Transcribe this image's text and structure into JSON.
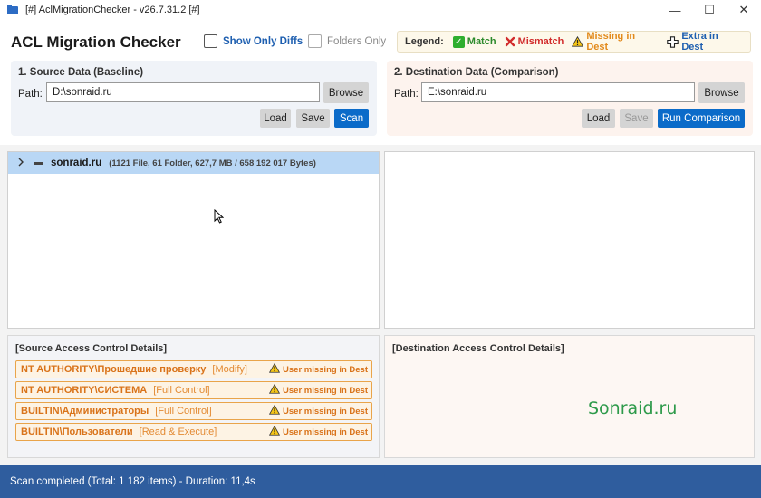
{
  "window": {
    "title": "[#] AclMigrationChecker - v26.7.31.2 [#]",
    "minimize": "—",
    "maximize": "☐",
    "close": "✕"
  },
  "header": {
    "app_title": "ACL Migration Checker",
    "show_only_diffs": "Show Only Diffs",
    "folders_only": "Folders Only"
  },
  "legend": {
    "label": "Legend:",
    "match": "Match",
    "mismatch": "Mismatch",
    "missing": "Missing in Dest",
    "extra": "Extra in Dest",
    "colors": {
      "match": "#2b8a2b",
      "mismatch": "#d12b2b",
      "missing": "#e28a1c",
      "extra": "#1e5fb0"
    }
  },
  "source": {
    "title": "1. Source Data (Baseline)",
    "path_label": "Path:",
    "path_value": "D:\\sonraid.ru",
    "browse": "Browse",
    "load": "Load",
    "save": "Save",
    "scan": "Scan"
  },
  "dest": {
    "title": "2. Destination Data (Comparison)",
    "path_label": "Path:",
    "path_value": "E:\\sonraid.ru",
    "browse": "Browse",
    "load": "Load",
    "save": "Save",
    "run": "Run Comparison"
  },
  "tree": {
    "root_name": "sonraid.ru",
    "root_info": "(1121 File, 61 Folder, 627,7 MB / 658 192 017 Bytes)"
  },
  "source_details": {
    "title": "[Source Access Control Details]",
    "rows": [
      {
        "who": "NT AUTHORITY\\Прошедшие проверку",
        "perm": "[Modify]",
        "status": "User missing in Dest"
      },
      {
        "who": "NT AUTHORITY\\СИСТЕМА",
        "perm": "[Full Control]",
        "status": "User missing in Dest"
      },
      {
        "who": "BUILTIN\\Администраторы",
        "perm": "[Full Control]",
        "status": "User missing in Dest"
      },
      {
        "who": "BUILTIN\\Пользователи",
        "perm": "[Read & Execute]",
        "status": "User missing in Dest"
      }
    ]
  },
  "dest_details": {
    "title": "[Destination Access Control Details]",
    "watermark": "Sonraid.ru"
  },
  "status": {
    "text": "Scan completed (Total: 1 182 items) - Duration: 11,4s"
  }
}
